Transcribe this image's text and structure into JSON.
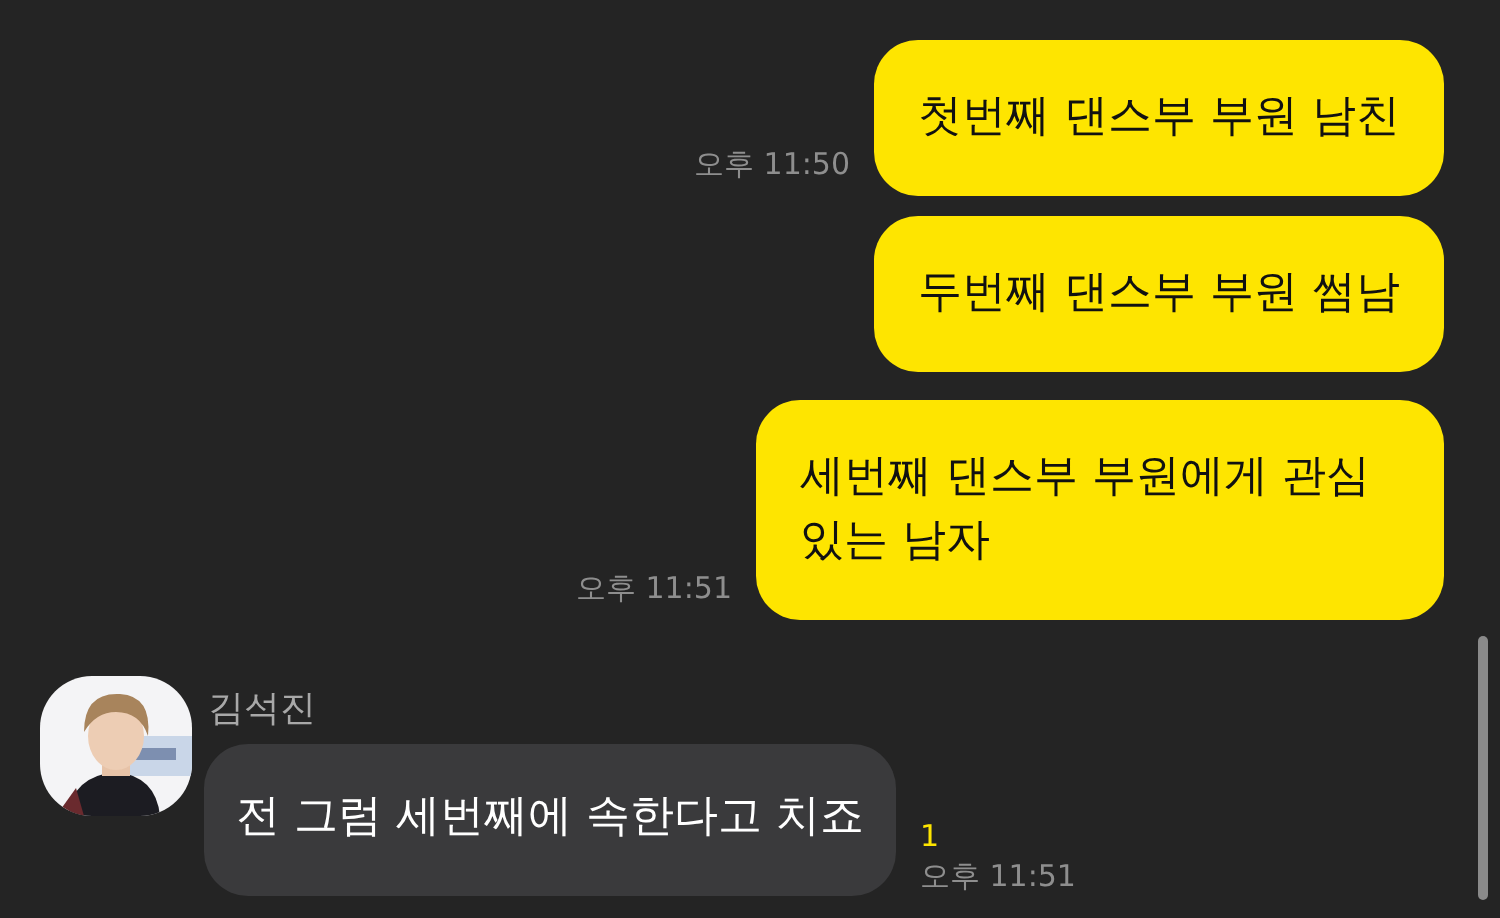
{
  "messages": [
    {
      "kind": "outgoing",
      "text": "첫번째 댄스부 부원 남친",
      "time": "오후 11:50"
    },
    {
      "kind": "outgoing",
      "text": "두번째 댄스부 부원 썸남"
    },
    {
      "kind": "outgoing",
      "text": "세번째 댄스부 부원에게 관심 있는 남자",
      "time": "오후 11:51"
    },
    {
      "kind": "incoming",
      "sender": "김석진",
      "text": "전 그럼 세번째에 속한다고 치죠",
      "unread": "1",
      "time": "오후 11:51"
    }
  ]
}
